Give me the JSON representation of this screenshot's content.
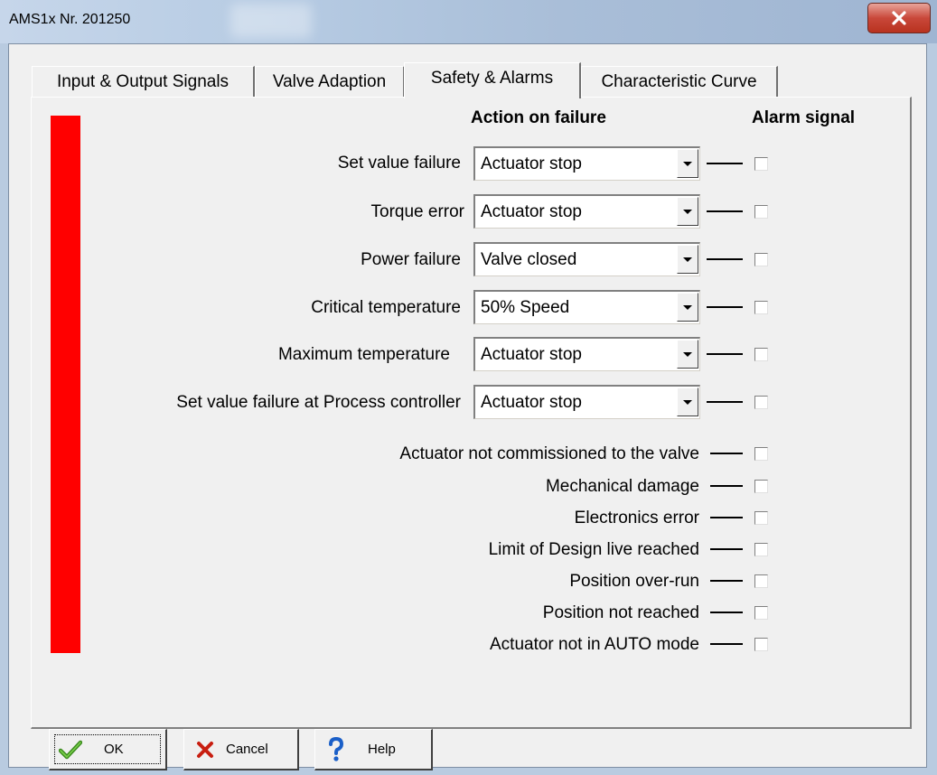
{
  "window": {
    "title": "AMS1x Nr. 201250"
  },
  "tabs": [
    {
      "label": "Input & Output Signals",
      "active": false
    },
    {
      "label": "Valve Adaption",
      "active": false
    },
    {
      "label": "Safety & Alarms",
      "active": true
    },
    {
      "label": "Characteristic Curve",
      "active": false
    }
  ],
  "headers": {
    "action": "Action on failure",
    "alarm": "Alarm signal"
  },
  "status_color": "#ff0000",
  "failure_rows": [
    {
      "label": "Set value failure",
      "action": "Actuator stop",
      "alarm": false
    },
    {
      "label": "Torque error",
      "action": "Actuator stop",
      "alarm": false
    },
    {
      "label": "Power failure",
      "action": "Valve closed",
      "alarm": false
    },
    {
      "label": "Critical temperature",
      "action": "50% Speed",
      "alarm": false
    },
    {
      "label": "Maximum temperature",
      "action": "Actuator stop",
      "alarm": false
    },
    {
      "label": "Set value failure at Process controller",
      "action": "Actuator stop",
      "alarm": false
    }
  ],
  "alarm_rows": [
    {
      "label": "Actuator not commissioned to the valve",
      "alarm": false
    },
    {
      "label": "Mechanical damage",
      "alarm": false
    },
    {
      "label": "Electronics error",
      "alarm": false
    },
    {
      "label": "Limit of Design live reached",
      "alarm": false
    },
    {
      "label": "Position over-run",
      "alarm": false
    },
    {
      "label": "Position not reached",
      "alarm": false
    },
    {
      "label": "Actuator not in AUTO mode",
      "alarm": false
    }
  ],
  "buttons": {
    "ok": "OK",
    "cancel": "Cancel",
    "help": "Help"
  },
  "icons": {
    "close": "close-icon",
    "ok": "checkmark-icon",
    "cancel": "x-icon",
    "help": "question-mark-icon"
  }
}
